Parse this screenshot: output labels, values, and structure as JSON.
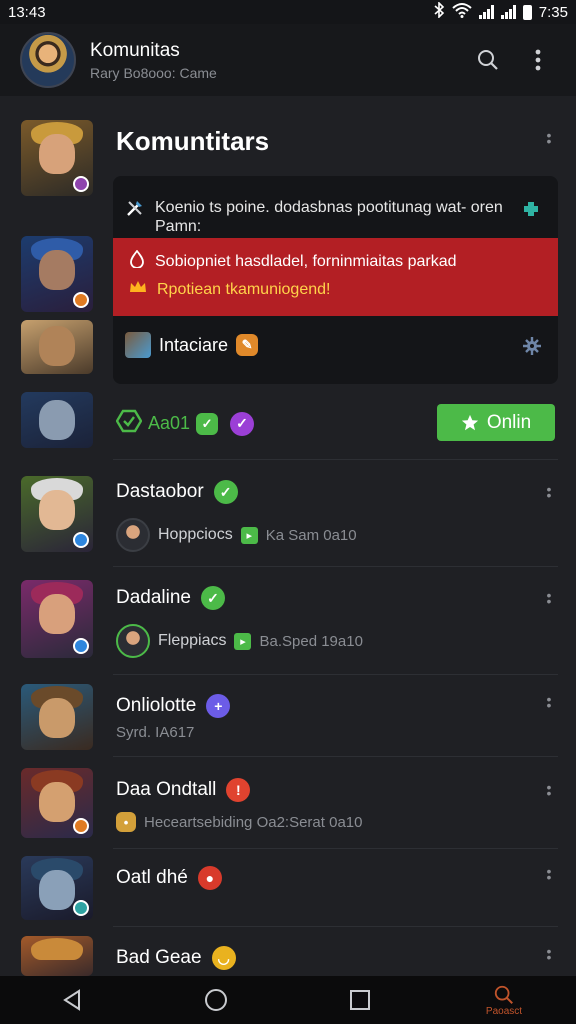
{
  "status_bar": {
    "time_left": "13:43",
    "time_right": "7:35"
  },
  "app_bar": {
    "title": "Komunitas",
    "subtitle": "Rary Bo8ooo: Came"
  },
  "group": {
    "title": "Komuntitars",
    "card": {
      "message": "Koenio ts poine. dodasbnas pootitunag wat- oren Pamn:",
      "alert_line1": "Sobiopniet hasdladel, forninmiaitas parkad",
      "alert_line2": "Rpotiean tkamuniogend!",
      "action_label": "Intaciare"
    }
  },
  "online_row": {
    "tag": "Aa01",
    "button_label": "Onlin"
  },
  "items": [
    {
      "name": "Dastaobor",
      "sub_name": "Hoppciocs",
      "sub_meta": "Ka Sam 0a10",
      "check_color": "#4cba48"
    },
    {
      "name": "Dadaline",
      "sub_name": "Fleppiacs",
      "sub_meta": "Ba.Sped 19a10",
      "check_color": "#4cba48"
    },
    {
      "name": "Onliolotte",
      "sub_meta": "Syrd. IA617",
      "check_color": "#6c5ce7"
    },
    {
      "name": "Daa Ondtall",
      "sub_meta": "Heceartsebiding Oa2:Serat 0a10",
      "check_color": "#e0432f"
    },
    {
      "name": "Oatl dhé",
      "check_color": "#d83a2b"
    },
    {
      "name": "Bad Geae",
      "check_color": "#e9b21f"
    }
  ],
  "nav": {
    "search_label": "Paoasct"
  },
  "colors": {
    "accent_green": "#4cba48",
    "alert_red": "#b31f24",
    "alert_yellow": "#ffd34a",
    "background": "#1f2024"
  }
}
